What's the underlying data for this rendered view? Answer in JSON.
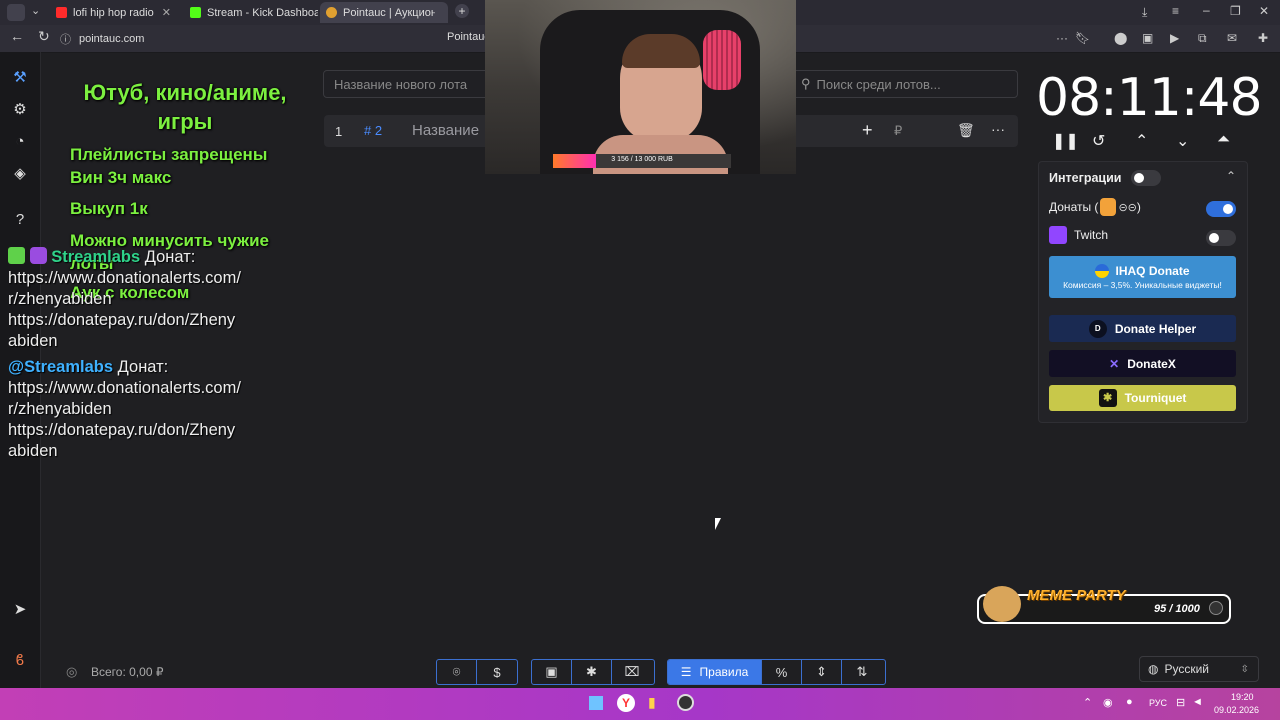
{
  "tabs": [
    {
      "label": "lofi hip hop radio",
      "color": "#ff2b2b"
    },
    {
      "label": "Stream - Kick Dashboard",
      "color": "#53fc18"
    },
    {
      "label": "Pointauc | Аукцион дл",
      "color": "#e0a030"
    }
  ],
  "address": {
    "url": "pointauc.com",
    "page_title": "Pointauc"
  },
  "overlay": {
    "title": "Ютуб, кино/аниме, игры",
    "rules": [
      "Плейлисты запрещены",
      "Вин 3ч макс",
      "Выкуп 1к",
      "Можно минусить чужие лоты",
      "Аук с колесом"
    ]
  },
  "chat": [
    {
      "name": "Streamlabs",
      "text": "Донат: https://www.donationalerts.com/ r/zhenyabiden https://donatepay.ru/don/Zheny abiden"
    },
    {
      "name": "@Streamlabs",
      "text": "Донат: https://www.donationalerts.com/ r/zhenyabiden https://donatepay.ru/don/Zheny abiden"
    }
  ],
  "main": {
    "new_lot_placeholder": "Название нового лота",
    "search_placeholder": "Поиск среди лотов...",
    "lot": {
      "index": "1",
      "tag": "# 2",
      "name": "Название",
      "currency": "₽"
    }
  },
  "webcam": {
    "progress_text": "3 156 / 13 000 RUB",
    "progress": 0.243
  },
  "timer": {
    "value": "08:11:48"
  },
  "integrations": {
    "title": "Интеграции",
    "donations_label": "Донаты (",
    "donations_suffix": ")",
    "twitch_label": "Twitch",
    "donations_on": true,
    "twitch_on": false
  },
  "donate_buttons": {
    "ihaq": {
      "title": "IHAQ Donate",
      "subtitle": "Комиссия – 3,5%. Уникальные виджеты!"
    },
    "helper": "Donate Helper",
    "donatex": "DonateX",
    "tourniquet": "Tourniquet"
  },
  "meme_party": {
    "title": "MEME PARTY",
    "count": "95 / 1000"
  },
  "footer": {
    "total": "Всего: 0,00 ₽",
    "rules_button": "Правила",
    "language": "Русский"
  },
  "taskbar": {
    "lang": "РУС",
    "time": "19:20",
    "date": "09.02.2026"
  }
}
